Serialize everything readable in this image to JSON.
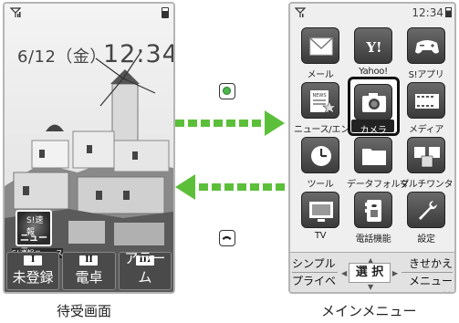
{
  "standby": {
    "date": "6/12（金）",
    "time": "12:34",
    "news_widget": {
      "line1": "S!速報",
      "line2": "ニュース",
      "caption": "S!速報ニュース"
    },
    "soft_keys": [
      {
        "num": "I",
        "label": "未登録"
      },
      {
        "num": "II",
        "label": "電卓"
      },
      {
        "num": "III",
        "label": "アラーム"
      }
    ],
    "caption": "待受画面"
  },
  "menu": {
    "clock": "12:34",
    "items": [
      {
        "label": "メール",
        "icon": "mail-icon"
      },
      {
        "label": "Yahoo!",
        "icon": "yahoo-icon"
      },
      {
        "label": "S!アプリ",
        "icon": "gamepad-icon"
      },
      {
        "label": "ニュース/エンタメ",
        "icon": "news-icon"
      },
      {
        "label": "カメラ",
        "icon": "camera-icon",
        "selected": true
      },
      {
        "label": "メディア",
        "icon": "film-icon"
      },
      {
        "label": "ツール",
        "icon": "clock-icon"
      },
      {
        "label": "データフォルダ",
        "icon": "folder-icon"
      },
      {
        "label": "マルチワンタッチ",
        "icon": "multi-icon"
      },
      {
        "label": "TV",
        "icon": "tv-icon"
      },
      {
        "label": "電話機能",
        "icon": "phone-book-icon"
      },
      {
        "label": "設定",
        "icon": "wrench-icon"
      }
    ],
    "bottom_left": [
      "シンプル",
      "プライベート"
    ],
    "bottom_center": "選 択",
    "bottom_right": [
      "きせかえ",
      "メニュー切替"
    ],
    "caption": "メインメニュー"
  },
  "colors": {
    "center_key": "#4cb84c",
    "arrow": "#5cbf3a"
  }
}
